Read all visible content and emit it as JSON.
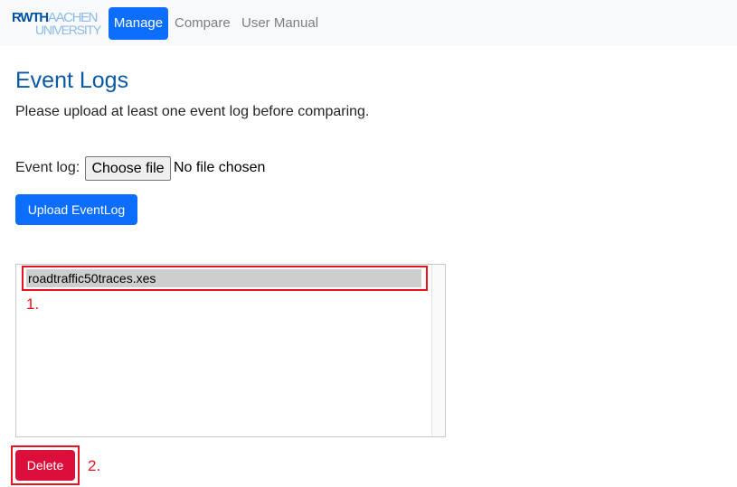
{
  "navbar": {
    "logo": {
      "line1_a": "RWTH",
      "line1_b": "AACHEN",
      "line2": "UNIVERSITY"
    },
    "items": [
      {
        "label": "Manage",
        "active": true
      },
      {
        "label": "Compare",
        "active": false
      },
      {
        "label": "User Manual",
        "active": false
      }
    ]
  },
  "main": {
    "title": "Event Logs",
    "intro": "Please upload at least one event log before comparing.",
    "file_input": {
      "label": "Event log:",
      "button_label": "Choose file",
      "status": "No file chosen"
    },
    "upload_label": "Upload EventLog",
    "event_logs": [
      {
        "name": "roadtraffic50traces.xes",
        "selected": true
      }
    ],
    "delete_label": "Delete"
  },
  "annotations": {
    "step1": "1.",
    "step2": "2.",
    "color": "#e8141b"
  },
  "colors": {
    "primary": "#0d6efd",
    "danger": "#dc0e3a",
    "title": "#0a58a8",
    "navbar_bg": "#f8f9fa"
  }
}
